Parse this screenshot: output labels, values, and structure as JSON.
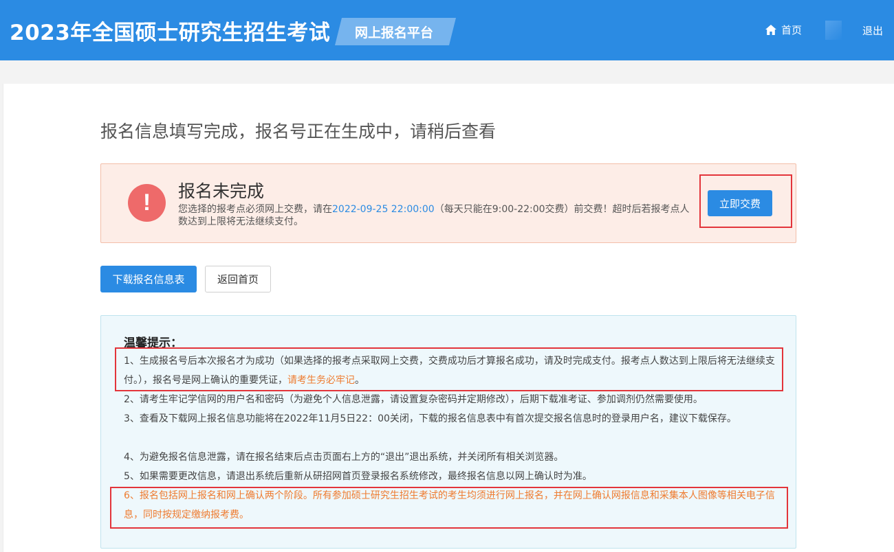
{
  "header": {
    "site_title": "2023年全国硕士研究生招生考试",
    "platform_badge": "网上报名平台",
    "home_label": "首页",
    "logout_label": "退出"
  },
  "page": {
    "heading": "报名信息填写完成，报名号正在生成中，请稍后查看"
  },
  "alert": {
    "icon": "exclamation-icon",
    "title": "报名未完成",
    "desc_before": "您选择的报考点必须网上交费，请在",
    "deadline": "2022-09-25 22:00:00",
    "desc_after": "（每天只能在9:00-22:00交费）前交费！超时后若报考点人数达到上限将无法继续支付。",
    "pay_button": "立即交费"
  },
  "actions": {
    "download_label": "下载报名信息表",
    "back_label": "返回首页"
  },
  "tips": {
    "title": "温馨提示：",
    "tip1_main": "1、生成报名号后本次报名才为成功（如果选择的报考点采取网上交费，交费成功后才算报名成功，请及时完成支付。报考点人数达到上限后将无法继续支付。），报名号是网上确认的重要凭证，",
    "tip1_emphasis": "请考生务必牢记",
    "tip1_end": "。",
    "tip2": "2、请考生牢记学信网的用户名和密码（为避免个人信息泄露，请设置复杂密码并定期修改），后期下载准考证、参加调剂仍然需要使用。",
    "tip3": "3、查看及下载网上报名信息功能将在2022年11月5日22：00关闭，下载的报名信息表中有首次提交报名信息时的登录用户名，建议下载保存。",
    "tip4": "4、为避免报名信息泄露，请在报名结束后点击页面右上方的“退出”退出系统，并关闭所有相关浏览器。",
    "tip5": "5、如果需要更改信息，请退出系统后重新从研招网首页登录报名系统修改，最终报名信息以网上确认时为准。",
    "tip6": "6、报名包括网上报名和网上确认两个阶段。所有参加硕士研究生招生考试的考生均须进行网上报名，并在网上确认网报信息和采集本人图像等相关电子信息，同时按规定缴纳报考费。"
  },
  "colors": {
    "header_bg": "#2b8be3",
    "accent_blue": "#2b8be3",
    "alert_bg": "#fdede7",
    "alert_icon": "#ee6a6a",
    "tips_bg": "#eef8fc",
    "emphasis_orange": "#ee7b2f",
    "highlight_red": "#e3343a"
  }
}
